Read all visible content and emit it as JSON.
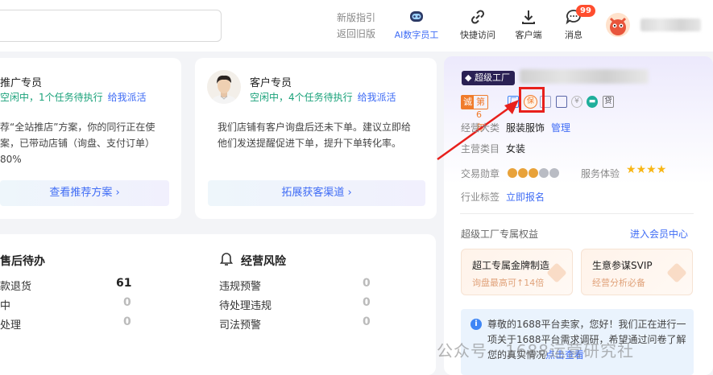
{
  "topbar": {
    "guide": [
      "新版指引",
      "返回旧版"
    ],
    "nav": [
      {
        "label": "AI数字员工",
        "icon": "robot-icon"
      },
      {
        "label": "快捷访问",
        "icon": "link-icon"
      },
      {
        "label": "客户端",
        "icon": "download-icon"
      },
      {
        "label": "消息",
        "icon": "message-icon",
        "badge": "99"
      }
    ]
  },
  "agents": [
    {
      "name": "推广专员",
      "status": "空闲中，1个任务待执行",
      "dispatch": "给我派活",
      "desc": [
        "荐“全站推店”方案，你的同行正在使",
        "案，已带动店铺（询盘、支付订单）",
        "80%"
      ],
      "action": "查看推荐方案"
    },
    {
      "name": "客户专员",
      "status": "空闲中，4个任务待执行",
      "dispatch": "给我派活",
      "desc": [
        "我们店铺有客户询盘后还未下单。建议立即给",
        "他们发送提醒促进下单，提升下单转化率。"
      ],
      "action": "拓展获客渠道"
    }
  ],
  "todo": {
    "after_sales": {
      "title": "售后待办",
      "rows": [
        {
          "label": "款退货",
          "value": "61"
        },
        {
          "label": "中",
          "value": "0"
        },
        {
          "label": "处理",
          "value": "0"
        }
      ]
    },
    "risk": {
      "title": "经营风险",
      "rows": [
        {
          "label": "违规预警",
          "value": "0"
        },
        {
          "label": "待处理违规",
          "value": "0"
        },
        {
          "label": "司法预警",
          "value": "0"
        }
      ]
    }
  },
  "shop": {
    "tag": "超级工厂",
    "cheng_a": "诚",
    "cheng_b": "第6年",
    "labels": {
      "main_cat": "经营大类",
      "main_cat_val": "服装服饰",
      "manage": "管理",
      "main_type": "主营类目",
      "main_type_val": "女装",
      "medal": "交易勋章",
      "service": "服务体验",
      "industry": "行业标签",
      "apply": "立即报名"
    },
    "rights_title": "超级工厂专属权益",
    "member_center": "进入会员中心",
    "benefits": [
      {
        "title": "超工专属金牌制造",
        "sub": "询盘最高可↑14倍"
      },
      {
        "title": "生意参谋SVIP",
        "sub": "经营分析必备"
      }
    ],
    "notice": {
      "text": "尊敬的1688平台卖家，您好！我们正在进行一项关于1688平台需求调研，希望通过问卷了解您的真实情况",
      "link": "点击查看"
    },
    "watermark": "公众号 · 1688运营研究社"
  },
  "colors": {
    "accent": "#3f6cf5",
    "status_green": "#1aa27a",
    "badge_red": "#ff4d2e",
    "highlight_red": "#e8201c"
  }
}
